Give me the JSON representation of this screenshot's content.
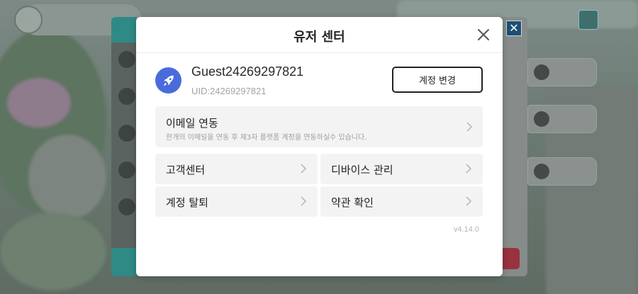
{
  "modal": {
    "title": "유저 센터",
    "user": {
      "name": "Guest24269297821",
      "uid": "UID:24269297821"
    },
    "switch_account_label": "계정 변경",
    "email_link": {
      "title": "이메일 연동",
      "description": "한개의 이메일을 연동 후 제3자 플랫폼 계정을 연동하실수 있습니다."
    },
    "menu": [
      {
        "label": "고객센터"
      },
      {
        "label": "디바이스 관리"
      },
      {
        "label": "계정 탈퇴"
      },
      {
        "label": "약관 확인"
      }
    ],
    "version": "v4.14.0"
  },
  "icons": {
    "close": "close-icon",
    "avatar": "rocket-icon",
    "chevron": "chevron-right-icon"
  },
  "colors": {
    "avatar_bg": "#4a6bdc",
    "row_bg": "#f3f3f3",
    "side_close_bg": "#1f4e74",
    "teal_panel": "#2f8a86"
  }
}
